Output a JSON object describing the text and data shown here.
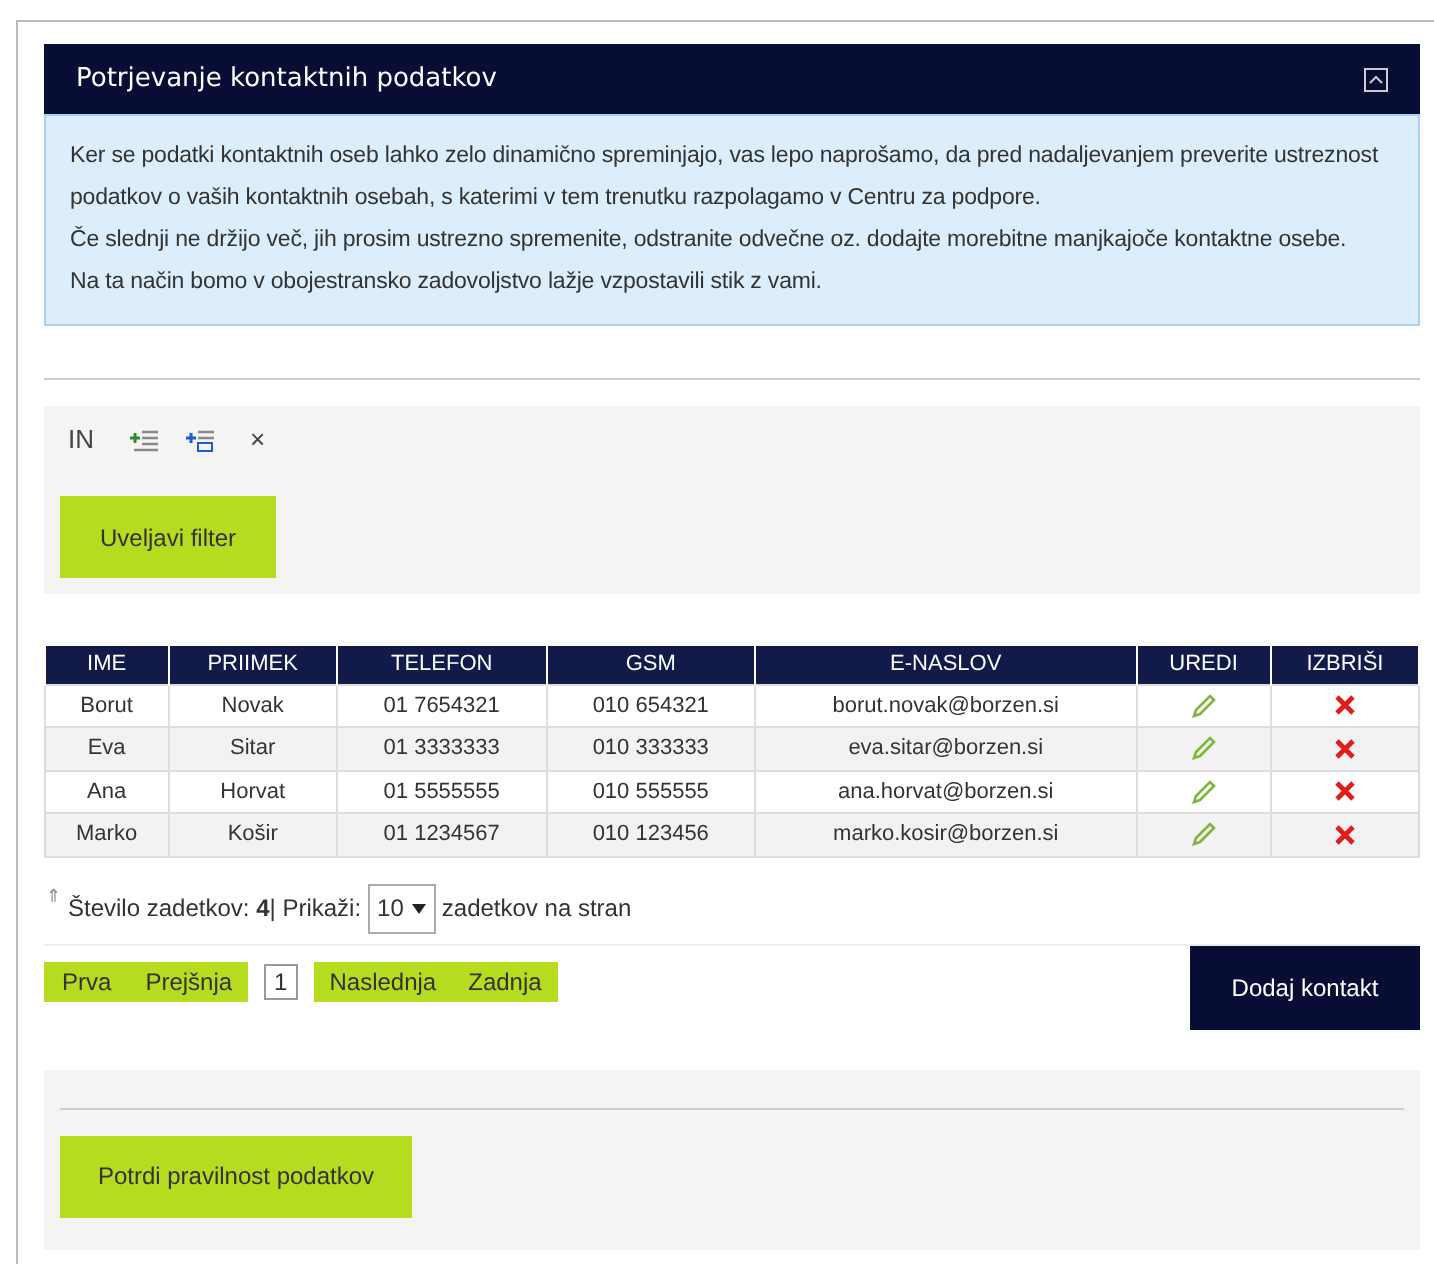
{
  "panel": {
    "title": "Potrjevanje kontaktnih podatkov"
  },
  "info": [
    "Ker se podatki kontaktnih oseb lahko zelo dinamično spreminjajo, vas lepo naprošamo, da pred nadaljevanjem preverite ustreznost podatkov o vaših kontaktnih osebah, s katerimi v tem trenutku razpolagamo v Centru za podpore.",
    "Če slednji ne držijo več, jih prosim ustrezno spremenite, odstranite odvečne oz. dodajte morebitne manjkajoče kontaktne osebe.",
    "Na ta način bomo v obojestransko zadovoljstvo lažje vzpostavili stik z vami."
  ],
  "filter": {
    "toolbar": [
      {
        "kind": "text",
        "label": "IN"
      },
      {
        "kind": "add-row"
      },
      {
        "kind": "add-group"
      },
      {
        "kind": "text",
        "label": "×"
      }
    ],
    "apply_button": "Uveljavi filter"
  },
  "table": {
    "columns": [
      "IME",
      "PRIIMEK",
      "TELEFON",
      "GSM",
      "E-NASLOV",
      "UREDI",
      "IZBRIŠI"
    ],
    "rows": [
      [
        "Borut",
        "Novak",
        "01 7654321",
        "010 654321",
        "borut.novak@borzen.si"
      ],
      [
        "Eva",
        "Sitar",
        "01 3333333",
        "010 333333",
        "eva.sitar@borzen.si"
      ],
      [
        "Ana",
        "Horvat",
        "01 5555555",
        "010 555555",
        "ana.horvat@borzen.si"
      ],
      [
        "Marko",
        "Košir",
        "01 1234567",
        "010 123456",
        "marko.kosir@borzen.si"
      ]
    ]
  },
  "summary": {
    "icon": "⇑",
    "text": "Število zadetkov: **4**| Prikaži:",
    "page_size": "10",
    "suffix": "zadetkov na stran"
  },
  "pager": {
    "first": "Prva",
    "previous": "Prejšnja",
    "page": "1",
    "next": "Naslednja",
    "last": "Zadnja"
  },
  "add_button": "Dodaj kontakt",
  "confirm_button": "Potrdi pravilnost podatkov"
}
